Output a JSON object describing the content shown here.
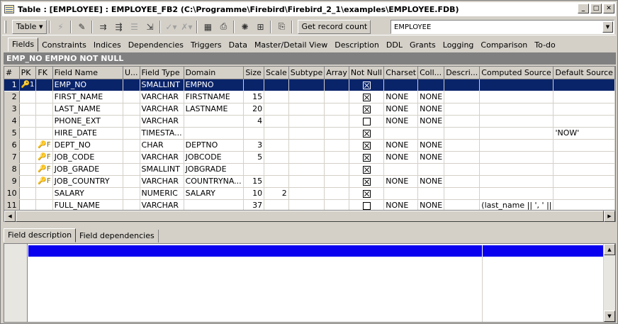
{
  "window": {
    "title": "Table : [EMPLOYEE] : EMPLOYEE_FB2 (C:\\Programme\\Firebird\\Firebird_2_1\\examples\\EMPLOYEE.FDB)",
    "minimize_label": "_",
    "maximize_label": "□",
    "close_label": "✕"
  },
  "toolbar": {
    "table_label": "Table ▾",
    "get_record_count_label": "Get record count",
    "table_selector_value": "EMPLOYEE",
    "icons": [
      "lightning-icon",
      "edit-icon",
      "indent-icon",
      "outdent-icon",
      "list-icon",
      "export-icon",
      "check-icon",
      "cancel-icon",
      "calendar-icon",
      "print-icon",
      "config-icon",
      "tree-icon",
      "compile-icon"
    ]
  },
  "tabs": [
    {
      "label": "Fields",
      "active": true
    },
    {
      "label": "Constraints"
    },
    {
      "label": "Indices"
    },
    {
      "label": "Dependencies"
    },
    {
      "label": "Triggers"
    },
    {
      "label": "Data"
    },
    {
      "label": "Master/Detail View"
    },
    {
      "label": "Description"
    },
    {
      "label": "DDL"
    },
    {
      "label": "Grants"
    },
    {
      "label": "Logging"
    },
    {
      "label": "Comparison"
    },
    {
      "label": "To-do"
    }
  ],
  "section_header": "EMP_NO EMPNO NOT NULL",
  "grid": {
    "columns": [
      "#",
      "PK",
      "FK",
      "Field Name",
      "U...",
      "Field Type",
      "Domain",
      "Size",
      "Scale",
      "Subtype",
      "Array",
      "Not Null",
      "Charset",
      "Coll...",
      "Descri...",
      "Computed Source",
      "Default Source"
    ],
    "rows": [
      {
        "n": "1",
        "pk": "🔑1",
        "fk": "",
        "name": "EMP_NO",
        "type": "SMALLINT",
        "domain": "EMPNO",
        "size": "",
        "scale": "",
        "notnull": true,
        "charset": "",
        "coll": "",
        "computed": "",
        "default": ""
      },
      {
        "n": "2",
        "pk": "",
        "fk": "",
        "name": "FIRST_NAME",
        "type": "VARCHAR",
        "domain": "FIRSTNAME",
        "size": "15",
        "scale": "",
        "notnull": true,
        "charset": "NONE",
        "coll": "NONE",
        "computed": "",
        "default": ""
      },
      {
        "n": "3",
        "pk": "",
        "fk": "",
        "name": "LAST_NAME",
        "type": "VARCHAR",
        "domain": "LASTNAME",
        "size": "20",
        "scale": "",
        "notnull": true,
        "charset": "NONE",
        "coll": "NONE",
        "computed": "",
        "default": ""
      },
      {
        "n": "4",
        "pk": "",
        "fk": "",
        "name": "PHONE_EXT",
        "type": "VARCHAR",
        "domain": "",
        "size": "4",
        "scale": "",
        "notnull": false,
        "charset": "NONE",
        "coll": "NONE",
        "computed": "",
        "default": ""
      },
      {
        "n": "5",
        "pk": "",
        "fk": "",
        "name": "HIRE_DATE",
        "type": "TIMESTA...",
        "domain": "",
        "size": "",
        "scale": "",
        "notnull": true,
        "charset": "",
        "coll": "",
        "computed": "",
        "default": "'NOW'"
      },
      {
        "n": "6",
        "pk": "",
        "fk": "🔑F",
        "name": "DEPT_NO",
        "type": "CHAR",
        "domain": "DEPTNO",
        "size": "3",
        "scale": "",
        "notnull": true,
        "charset": "NONE",
        "coll": "NONE",
        "computed": "",
        "default": ""
      },
      {
        "n": "7",
        "pk": "",
        "fk": "🔑F",
        "name": "JOB_CODE",
        "type": "VARCHAR",
        "domain": "JOBCODE",
        "size": "5",
        "scale": "",
        "notnull": true,
        "charset": "NONE",
        "coll": "NONE",
        "computed": "",
        "default": ""
      },
      {
        "n": "8",
        "pk": "",
        "fk": "🔑F",
        "name": "JOB_GRADE",
        "type": "SMALLINT",
        "domain": "JOBGRADE",
        "size": "",
        "scale": "",
        "notnull": true,
        "charset": "",
        "coll": "",
        "computed": "",
        "default": ""
      },
      {
        "n": "9",
        "pk": "",
        "fk": "🔑F",
        "name": "JOB_COUNTRY",
        "type": "VARCHAR",
        "domain": "COUNTRYNA...",
        "size": "15",
        "scale": "",
        "notnull": true,
        "charset": "NONE",
        "coll": "NONE",
        "computed": "",
        "default": ""
      },
      {
        "n": "10",
        "pk": "",
        "fk": "",
        "name": "SALARY",
        "type": "NUMERIC",
        "domain": "SALARY",
        "size": "10",
        "scale": "2",
        "notnull": true,
        "charset": "",
        "coll": "",
        "computed": "",
        "default": ""
      },
      {
        "n": "11",
        "pk": "",
        "fk": "",
        "name": "FULL_NAME",
        "type": "VARCHAR",
        "domain": "",
        "size": "37",
        "scale": "",
        "notnull": false,
        "charset": "NONE",
        "coll": "NONE",
        "computed": "(last_name || ', ' ||",
        "default": ""
      }
    ]
  },
  "bottom_tabs": [
    {
      "label": "Field description",
      "active": true
    },
    {
      "label": "Field dependencies"
    }
  ]
}
